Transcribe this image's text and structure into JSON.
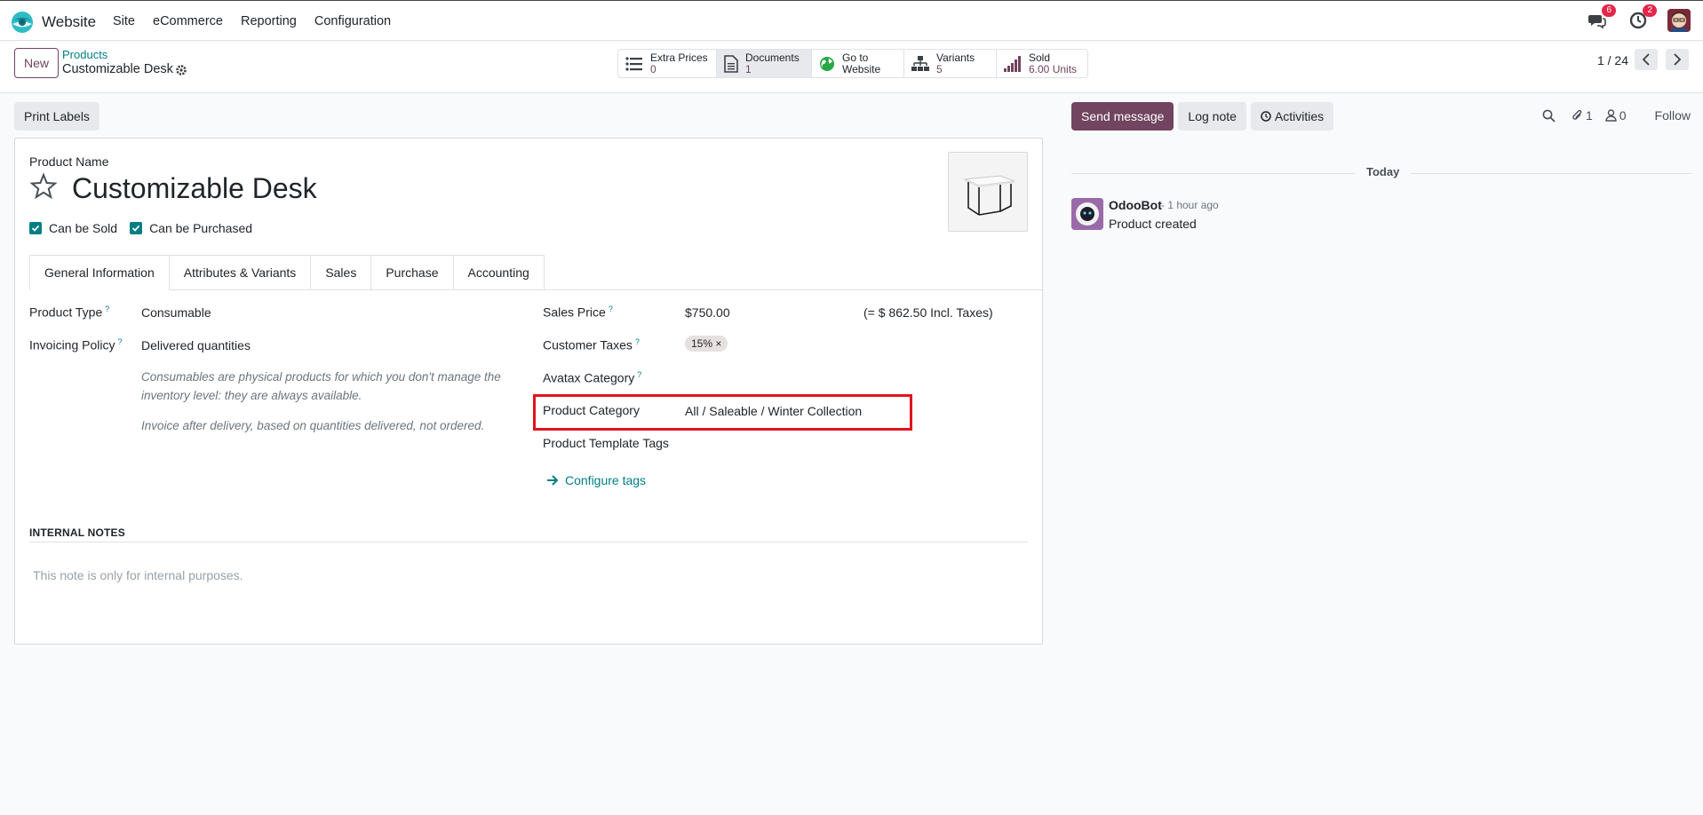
{
  "navbar": {
    "app_name": "Website",
    "menu": [
      "Site",
      "eCommerce",
      "Reporting",
      "Configuration"
    ],
    "messages_count": "6",
    "activities_count": "2"
  },
  "control_panel": {
    "new_label": "New",
    "breadcrumb_parent": "Products",
    "breadcrumb_current": "Customizable Desk",
    "smart_buttons": [
      {
        "label": "Extra Prices",
        "value": "0",
        "icon": "list-icon"
      },
      {
        "label": "Documents",
        "value": "1",
        "icon": "document-icon"
      },
      {
        "label": "Go to",
        "value": "Website",
        "icon": "globe-icon"
      },
      {
        "label": "Variants",
        "value": "5",
        "icon": "sitemap-icon"
      },
      {
        "label": "Sold",
        "value": "6.00 Units",
        "icon": "signal-icon"
      }
    ],
    "pager": "1 / 24"
  },
  "form": {
    "print_labels": "Print Labels",
    "product_name_label": "Product Name",
    "product_name": "Customizable Desk",
    "can_be_sold": "Can be Sold",
    "can_be_purchased": "Can be Purchased",
    "tabs": [
      "General Information",
      "Attributes & Variants",
      "Sales",
      "Purchase",
      "Accounting"
    ],
    "fields": {
      "product_type_label": "Product Type",
      "product_type": "Consumable",
      "invoicing_policy_label": "Invoicing Policy",
      "invoicing_policy": "Delivered quantities",
      "help_consumable": "Consumables are physical products for which you don't manage the inventory level: they are always available.",
      "help_invoice": "Invoice after delivery, based on quantities delivered, not ordered.",
      "sales_price_label": "Sales Price",
      "sales_price": "$750.00",
      "incl_taxes": "(= $ 862.50 Incl. Taxes)",
      "customer_taxes_label": "Customer Taxes",
      "customer_tax_tag": "15% ×",
      "avatax_label": "Avatax Category",
      "product_category_label": "Product Category",
      "product_category": "All / Saleable / Winter Collection",
      "template_tags_label": "Product Template Tags",
      "configure_tags": "Configure tags"
    },
    "internal_notes_heading": "INTERNAL NOTES",
    "internal_notes_placeholder": "This note is only for internal purposes."
  },
  "chatter": {
    "send_message": "Send message",
    "log_note": "Log note",
    "activities": "Activities",
    "attachments_count": "1",
    "followers_count": "0",
    "follow": "Follow",
    "date_separator": "Today",
    "message": {
      "author": "OdooBot",
      "time": "- 1 hour ago",
      "body": "Product created"
    }
  },
  "colors": {
    "primary": "#71445f",
    "link": "#017e84",
    "highlight": "#e0141e"
  }
}
